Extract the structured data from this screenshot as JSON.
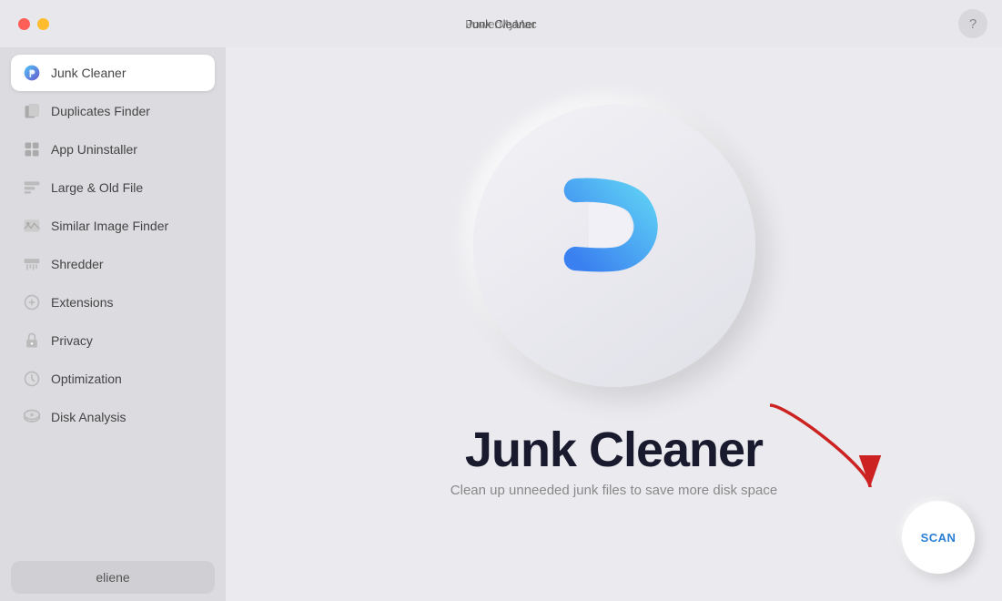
{
  "titlebar": {
    "app_name": "PowerMyMac",
    "window_title": "Junk Cleaner",
    "help_label": "?"
  },
  "sidebar": {
    "items": [
      {
        "id": "junk-cleaner",
        "label": "Junk Cleaner",
        "active": true
      },
      {
        "id": "duplicates-finder",
        "label": "Duplicates Finder",
        "active": false
      },
      {
        "id": "app-uninstaller",
        "label": "App Uninstaller",
        "active": false
      },
      {
        "id": "large-old-file",
        "label": "Large & Old File",
        "active": false
      },
      {
        "id": "similar-image-finder",
        "label": "Similar Image Finder",
        "active": false
      },
      {
        "id": "shredder",
        "label": "Shredder",
        "active": false
      },
      {
        "id": "extensions",
        "label": "Extensions",
        "active": false
      },
      {
        "id": "privacy",
        "label": "Privacy",
        "active": false
      },
      {
        "id": "optimization",
        "label": "Optimization",
        "active": false
      },
      {
        "id": "disk-analysis",
        "label": "Disk Analysis",
        "active": false
      }
    ],
    "user": "eliene"
  },
  "content": {
    "main_title": "Junk Cleaner",
    "sub_title": "Clean up unneeded junk files to save more disk space",
    "scan_label": "SCAN"
  }
}
